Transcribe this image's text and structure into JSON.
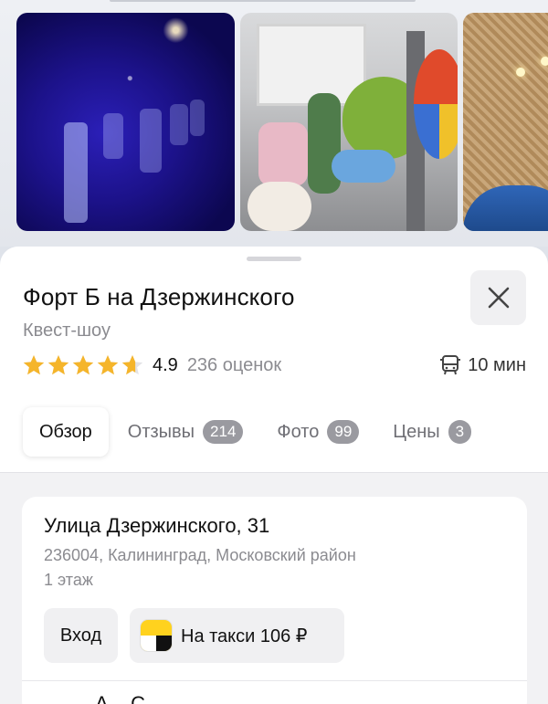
{
  "photos": [
    {
      "name": "photo-party-purple-lights"
    },
    {
      "name": "photo-kids-show"
    },
    {
      "name": "photo-fort-interior"
    }
  ],
  "place": {
    "title": "Форт Б на Дзержинского",
    "category": "Квест-шоу",
    "rating": "4.9",
    "rating_stars": 4.9,
    "reviews_count": "236 оценок",
    "transit_time": "10 мин",
    "transit_icon": "bus-icon"
  },
  "tabs": [
    {
      "label": "Обзор",
      "badge": ""
    },
    {
      "label": "Отзывы",
      "badge": "214"
    },
    {
      "label": "Фото",
      "badge": "99"
    },
    {
      "label": "Цены",
      "badge": "3"
    }
  ],
  "address": {
    "street": "Улица Дзержинского, 31",
    "city": "236004, Калининград, Московский район",
    "floor": "1 этаж",
    "entrance_label": "Вход",
    "taxi_label": "На такси 106 ₽",
    "next_item_partial": "А... С..."
  },
  "colors": {
    "star": "#f5b52b",
    "badge": "#9a9aa0",
    "taxi_yellow": "#ffd21e"
  }
}
